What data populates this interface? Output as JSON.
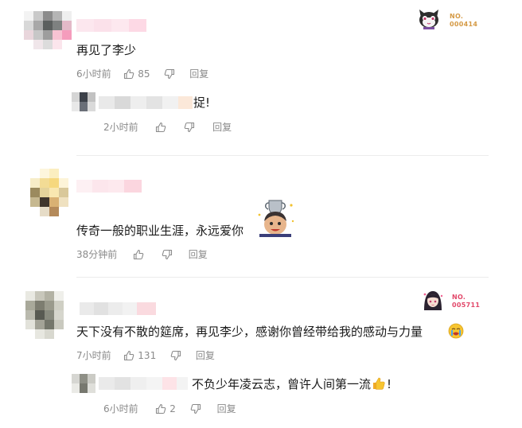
{
  "colors": {
    "text": "#1a1a1a",
    "meta": "#8a8a8a",
    "divider": "#ececec",
    "badge_gold": "#d59a45",
    "badge_pink": "#e2486a"
  },
  "comments": [
    {
      "text": "再见了李少",
      "time": "6小时前",
      "likes": "85",
      "reply_label": "回复",
      "badge": {
        "no": "NO.",
        "num": "000414",
        "icon": "cat-mascot-icon"
      },
      "replies": [
        {
          "text": "捉!",
          "time": "2小时前",
          "likes": "",
          "reply_label": "回复"
        }
      ]
    },
    {
      "text": "传奇一般的职业生涯，永远爱你",
      "time": "38分钟前",
      "likes": "",
      "reply_label": "回复",
      "sticker": "trophy-emoji-icon"
    },
    {
      "text": "天下没有不散的筵席，再见李少，感谢你曾经带给我的感动与力量",
      "time": "7小时前",
      "likes": "131",
      "reply_label": "回复",
      "badge": {
        "no": "NO.",
        "num": "005711",
        "icon": "anime-girl-avatar-icon"
      },
      "replies": [
        {
          "text": "不负少年凌云志，曾许人间第一流",
          "suffix": "!",
          "time": "6小时前",
          "likes": "2",
          "reply_label": "回复"
        }
      ]
    }
  ]
}
